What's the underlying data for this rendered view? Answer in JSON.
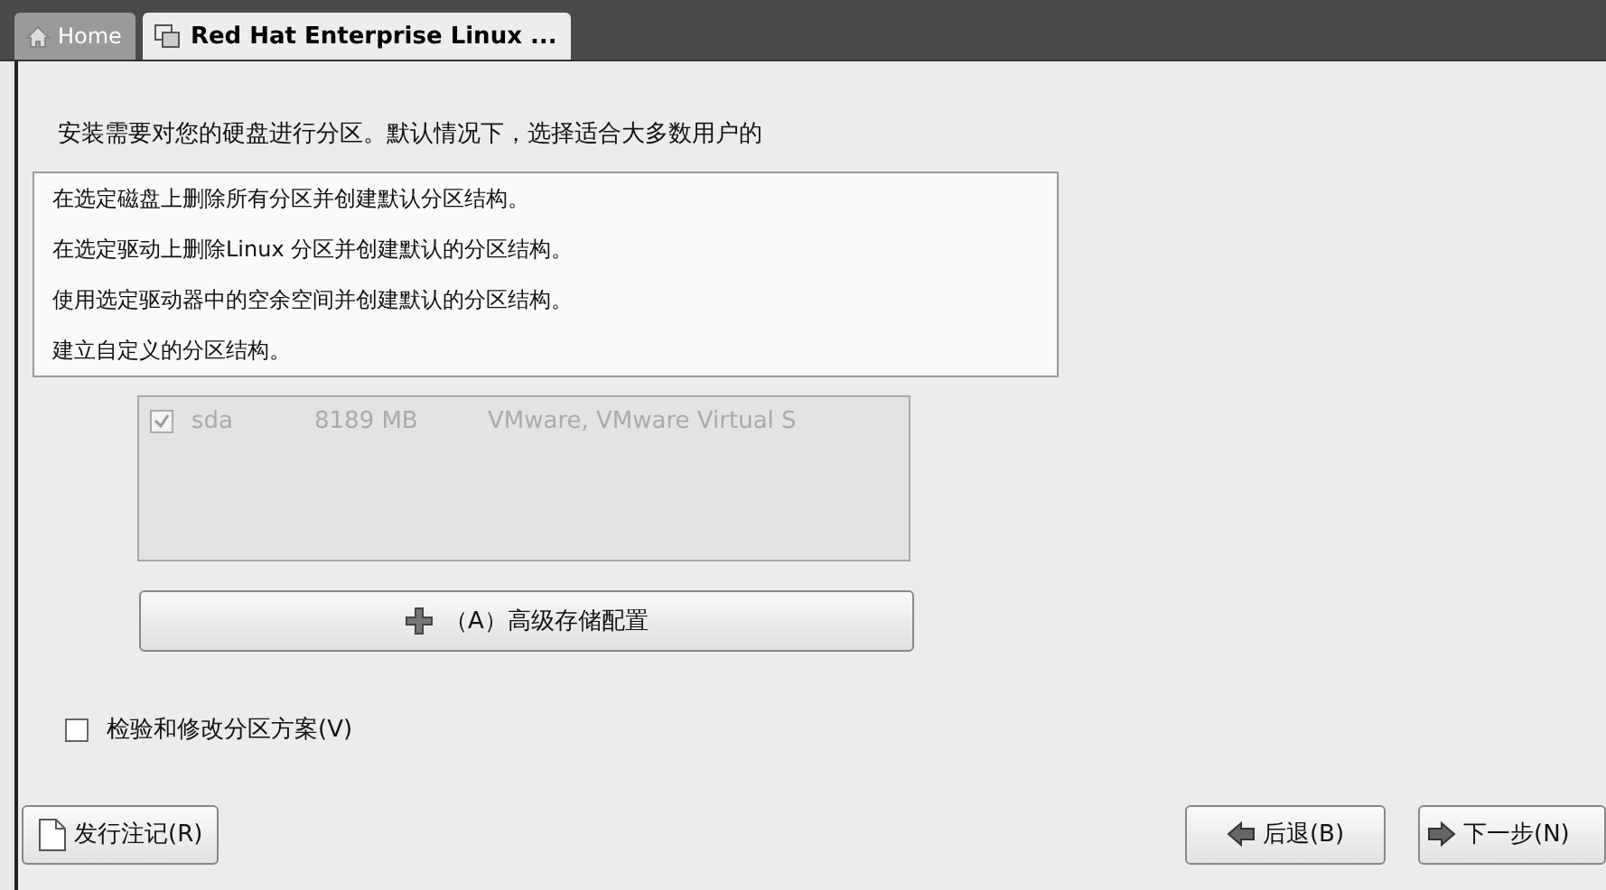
{
  "tabs": [
    {
      "label": "Home",
      "selected": false
    },
    {
      "label": "Red Hat Enterprise Linux ...",
      "selected": true
    }
  ],
  "intro": "安装需要对您的硬盘进行分区。默认情况下，选择适合大多数用户的",
  "dropdown_options": [
    {
      "label": "在选定磁盘上删除所有分区并创建默认分区结构。"
    },
    {
      "label": "在选定驱动上删除Linux 分区并创建默认的分区结构。"
    },
    {
      "label": "使用选定驱动器中的空余空间并创建默认的分区结构。"
    },
    {
      "label": "建立自定义的分区结构。"
    }
  ],
  "drives": [
    {
      "checked": true,
      "disabled": true,
      "name": "sda",
      "size": "8189 MB",
      "model": "VMware, VMware Virtual S"
    }
  ],
  "advanced_button": "（A）高级存储配置",
  "review_checkbox": {
    "label": "检验和修改分区方案(V)",
    "checked": false
  },
  "footer_buttons": [
    {
      "label": "发行注记(R)"
    },
    {
      "label": "后退(B)"
    },
    {
      "label": "下一步(N)"
    }
  ]
}
